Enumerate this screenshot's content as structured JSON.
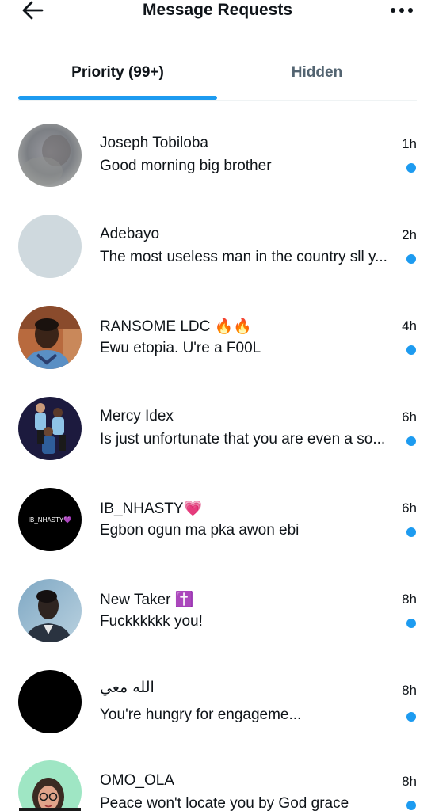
{
  "header": {
    "title": "Message Requests",
    "back_icon": "arrow-left-icon",
    "more_icon": "more-horizontal-icon"
  },
  "tabs": [
    {
      "label": "Priority (99+)",
      "active": true
    },
    {
      "label": "Hidden",
      "active": false
    }
  ],
  "colors": {
    "accent": "#1d9bf0",
    "text_primary": "#0f1419",
    "text_secondary": "#536471"
  },
  "conversations": [
    {
      "name": "Joseph Tobiloba",
      "preview": "Good morning big brother",
      "time": "1h",
      "unread": true,
      "avatar": "blurred-photo"
    },
    {
      "name": "Adebayo",
      "preview": "The most useless man in the country sll y...",
      "time": "2h",
      "unread": true,
      "avatar": "empty-placeholder"
    },
    {
      "name": "RANSOME LDC 🔥🔥",
      "preview": "Ewu etopia. U're a F00L",
      "time": "4h",
      "unread": true,
      "avatar": "photo-man"
    },
    {
      "name": "Mercy Idex",
      "preview": "Is just unfortunate that you are even a so...",
      "time": "6h",
      "unread": true,
      "avatar": "photo-group"
    },
    {
      "name": "IB_NHASTY💗",
      "preview": "Egbon ogun ma pka awon ebi",
      "time": "6h",
      "unread": true,
      "avatar": "text-logo",
      "avatar_text": "IB_NHASTY💜"
    },
    {
      "name": "New Taker ✝️",
      "preview": "Fuckkkkkk you!",
      "time": "8h",
      "unread": true,
      "avatar": "photo-profile"
    },
    {
      "name": "الله معي",
      "preview": "You're hungry for engageme...",
      "time": "8h",
      "unread": true,
      "avatar": "black"
    },
    {
      "name": "OMO_OLA",
      "preview": "Peace won't locate you by God grace",
      "time": "8h",
      "unread": true,
      "avatar": "cartoon-woman"
    }
  ]
}
